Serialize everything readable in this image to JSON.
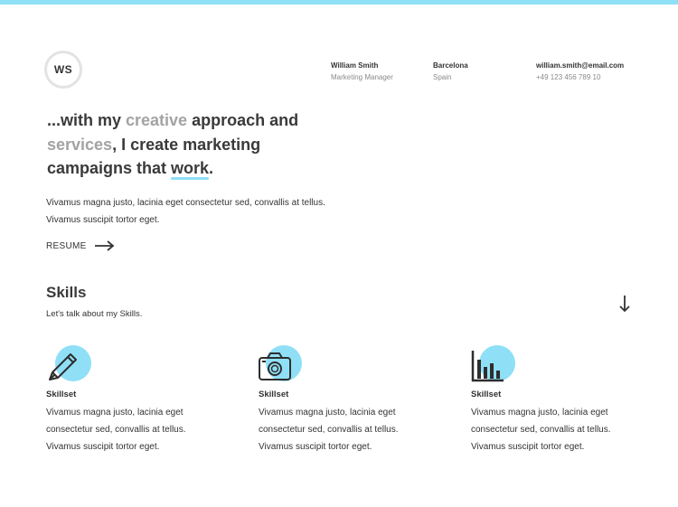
{
  "header": {
    "logo_text": "WS",
    "name": "William Smith",
    "role": "Marketing Manager",
    "city": "Barcelona",
    "country": "Spain",
    "email": "william.smith@email.com",
    "phone": "+49 123 456 789 10"
  },
  "hero": {
    "headline": {
      "p1": "...with my ",
      "w1": "creative",
      "p2": " approach and ",
      "w2": "services",
      "p3": ", I create marketing campaigns that ",
      "w3": "work",
      "p4": "."
    },
    "intro": "Vivamus magna justo, lacinia eget consectetur sed, convallis at tellus. Vivamus suscipit tortor eget.",
    "resume_label": "RESUME"
  },
  "skills": {
    "title": "Skills",
    "subtitle": "Let's talk about my Skills.",
    "items": [
      {
        "icon": "pen-icon",
        "name": "Skillset",
        "text": "Vivamus magna justo, lacinia eget consectetur sed, convallis at tellus. Vivamus suscipit tortor eget."
      },
      {
        "icon": "camera-icon",
        "name": "Skillset",
        "text": "Vivamus magna justo, lacinia eget consectetur sed, convallis at tellus. Vivamus suscipit tortor eget."
      },
      {
        "icon": "bar-chart-icon",
        "name": "Skillset",
        "text": "Vivamus magna justo, lacinia eget consectetur sed, convallis at tellus. Vivamus suscipit tortor eget."
      }
    ]
  },
  "colors": {
    "accent": "#8fe0f7",
    "text": "#3b3b3b",
    "muted": "#a3a3a3"
  }
}
